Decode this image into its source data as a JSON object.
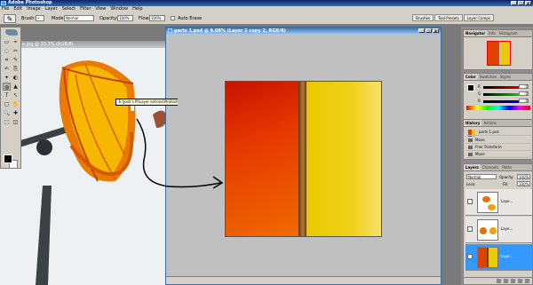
{
  "app": {
    "title": "Adobe Photoshop",
    "window_buttons": [
      "_",
      "□",
      "x"
    ]
  },
  "menu": [
    "File",
    "Edit",
    "Image",
    "Layer",
    "Select",
    "Filter",
    "View",
    "Window",
    "Help"
  ],
  "options": {
    "brush_label": "Brush:",
    "mode_label": "Mode:",
    "mode_value": "Normal",
    "opacity_label": "Opacity:",
    "opacity_value": "100%",
    "flow_label": "Flow:",
    "flow_value": "100%",
    "auto_erase_label": "Auto Erase"
  },
  "well_tabs": [
    "Brushes",
    "Tool Presets",
    "Layer Comps"
  ],
  "tools": {
    "glyphs": [
      "▭",
      "⌖",
      "◌",
      "✂",
      "⌗",
      "✎",
      "✍",
      "⎘",
      "✦",
      "◐",
      "◍",
      "▲",
      "T",
      "↖",
      "▢",
      "✋",
      "🔍",
      "✚",
      "⬚",
      "◫"
    ],
    "active_index": 10
  },
  "doc1": {
    "title": "e.jpg @ 33.3% (RGB/8)",
    "tooltip_path": "E:\\Josh's PI\\Layer entries\\Photoshop contests\\Umbrella\\sourceimage.jpg @ 33.3% (RGB/8#)"
  },
  "doc2": {
    "title": "parts 1.psd @ 9.08% (Layer 2 copy 2, RGB/8)",
    "status": ""
  },
  "navigator": {
    "tabs": [
      "Navigator",
      "Info",
      "Histogram"
    ]
  },
  "color_panel": {
    "tabs": [
      "Color",
      "Swatches",
      "Styles"
    ],
    "channels": [
      {
        "label": "R",
        "value": "0"
      },
      {
        "label": "G",
        "value": "0"
      },
      {
        "label": "B",
        "value": "0"
      }
    ]
  },
  "history": {
    "tabs": [
      "History",
      "Actions"
    ],
    "snapshot": "parts 1.psd",
    "steps": [
      "Move",
      "Free Transform",
      "Move"
    ]
  },
  "layers": {
    "tabs": [
      "Layers",
      "Channels",
      "Paths"
    ],
    "mode": "Normal",
    "opacity_label": "Opacity:",
    "opacity_value": "100%",
    "lock_label": "Lock:",
    "fill_label": "Fill:",
    "fill_value": "100%",
    "items": [
      {
        "name": "Laye..."
      },
      {
        "name": "Laye..."
      },
      {
        "name": "Laye..."
      }
    ]
  },
  "colors": {
    "accent": "#3a6ea5",
    "red_panel": "#e04000",
    "yellow_panel": "#ecc80a"
  }
}
